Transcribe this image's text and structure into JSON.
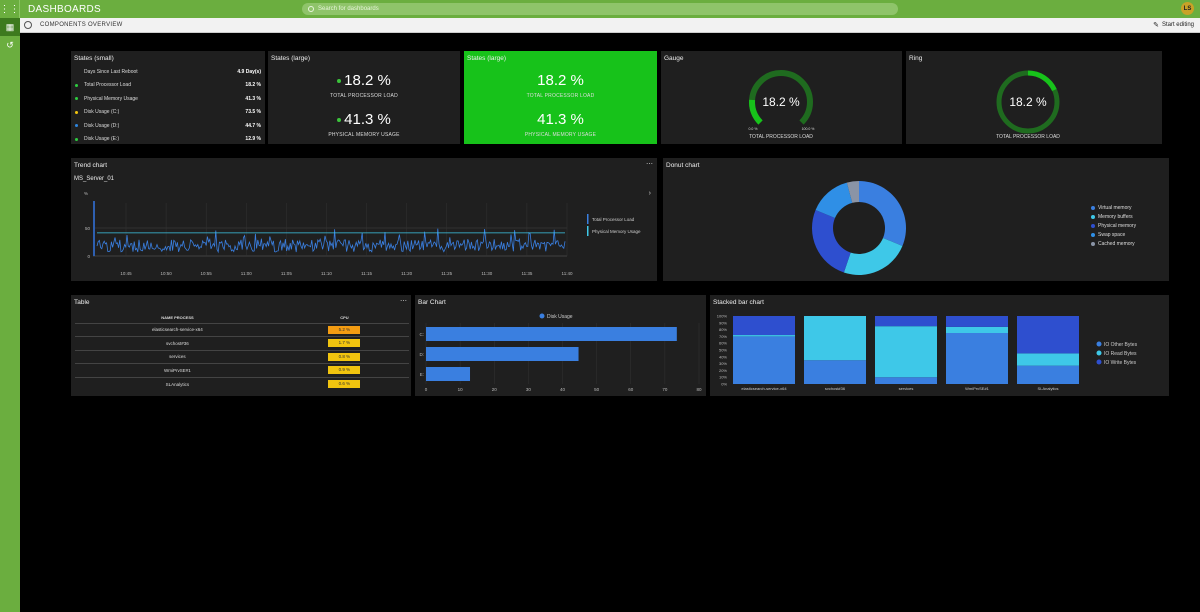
{
  "header": {
    "app_title": "DASHBOARDS",
    "search_placeholder": "Search for dashboards",
    "avatar_initials": "LS"
  },
  "subbar": {
    "breadcrumb": "COMPONENTS OVERVIEW",
    "edit_label": "Start editing"
  },
  "states_small": {
    "title": "States (small)",
    "rows": [
      {
        "label": "Days Since Last Reboot",
        "value": "4.9 Day(s)",
        "color": ""
      },
      {
        "label": "Total Processor Load",
        "value": "18.2 %",
        "color": "#2ecc40"
      },
      {
        "label": "Physical Memory Usage",
        "value": "41.3 %",
        "color": "#2ecc40"
      },
      {
        "label": "Disk Usage (C:)",
        "value": "73.5 %",
        "color": "#f1c40f"
      },
      {
        "label": "Disk Usage (D:)",
        "value": "44.7 %",
        "color": "#2e86de"
      },
      {
        "label": "Disk Usage (E:)",
        "value": "12.9 %",
        "color": "#2ecc40"
      }
    ]
  },
  "states_large": {
    "title": "States (large)",
    "v1": "18.2 %",
    "l1": "TOTAL PROCESSOR LOAD",
    "v2": "41.3 %",
    "l2": "PHYSICAL MEMORY USAGE"
  },
  "states_large_green": {
    "title": "States (large)",
    "v1": "18.2 %",
    "l1": "TOTAL PROCESSOR LOAD",
    "v2": "41.3 %",
    "l2": "PHYSICAL MEMORY USAGE"
  },
  "gauge": {
    "title": "Gauge",
    "value": "18.2 %",
    "label": "TOTAL PROCESSOR LOAD",
    "min": "0.0 %",
    "max": "100.0 %",
    "fraction": 0.182,
    "color": "#17c21a"
  },
  "ring": {
    "title": "Ring",
    "value": "18.2 %",
    "label": "TOTAL PROCESSOR LOAD",
    "fraction": 0.182,
    "color": "#17c21a"
  },
  "trend": {
    "title": "Trend chart",
    "server": "MS_Server_01",
    "unit": "%",
    "y_ticks": [
      "50",
      "0"
    ],
    "x_ticks": [
      "10:45",
      "10:50",
      "10:55",
      "11:00",
      "11:05",
      "11:10",
      "11:15",
      "11:20",
      "11:25",
      "11:30",
      "11:35",
      "11:40"
    ],
    "legend": [
      "Total Processor Load",
      "Physical Memory Usage"
    ]
  },
  "donut": {
    "title": "Donut chart",
    "slices": [
      {
        "name": "Virtual memory",
        "value": 30,
        "color": "#3a7fe0"
      },
      {
        "name": "Memory buffers",
        "value": 23,
        "color": "#3ec8e8"
      },
      {
        "name": "Physical memory",
        "value": 25,
        "color": "#2e4fcf"
      },
      {
        "name": "Swap space",
        "value": 14,
        "color": "#2f8fe6"
      },
      {
        "name": "Cached memory",
        "value": 4,
        "color": "#8a94a6"
      }
    ]
  },
  "table": {
    "title": "Table",
    "headers": [
      "NAME PROCESS",
      "CPU"
    ],
    "rows": [
      {
        "name": "elasticsearch-service-x64",
        "cpu": "5.2 %",
        "color": "#f39c12"
      },
      {
        "name": "svchost#36",
        "cpu": "1.7 %",
        "color": "#f1c40f"
      },
      {
        "name": "services",
        "cpu": "0.8 %",
        "color": "#f1c40f"
      },
      {
        "name": "WmiPrvSE#1",
        "cpu": "0.9 %",
        "color": "#f1c40f"
      },
      {
        "name": "SLAnalytics",
        "cpu": "0.6 %",
        "color": "#f1c40f"
      }
    ]
  },
  "chart_data": [
    {
      "type": "bar",
      "title": "Bar Chart",
      "orientation": "horizontal",
      "categories": [
        "C:",
        "D:",
        "E:"
      ],
      "series": [
        {
          "name": "Disk Usage",
          "values": [
            73.5,
            44.7,
            12.9
          ],
          "color": "#3a7fe0"
        }
      ],
      "xlim": [
        0,
        80
      ],
      "x_ticks": [
        "0",
        "10",
        "20",
        "30",
        "40",
        "50",
        "60",
        "70",
        "80"
      ]
    },
    {
      "type": "bar",
      "title": "Stacked bar chart",
      "stacked": "percent",
      "categories": [
        "elasticsearch-service-x64",
        "svchost#36",
        "services",
        "WmiPrvSE#1",
        "SLAnalytics"
      ],
      "series": [
        {
          "name": "IO Other Bytes",
          "values": [
            70,
            35,
            10,
            75,
            27
          ],
          "color": "#3a7fe0"
        },
        {
          "name": "IO Read Bytes",
          "values": [
            2,
            65,
            75,
            9,
            18
          ],
          "color": "#3ec8e8"
        },
        {
          "name": "IO Write Bytes",
          "values": [
            28,
            0,
            15,
            16,
            55
          ],
          "color": "#2e4fcf"
        }
      ],
      "y_ticks": [
        "100%",
        "90%",
        "80%",
        "70%",
        "60%",
        "50%",
        "40%",
        "30%",
        "20%",
        "10%",
        "0%"
      ]
    }
  ]
}
